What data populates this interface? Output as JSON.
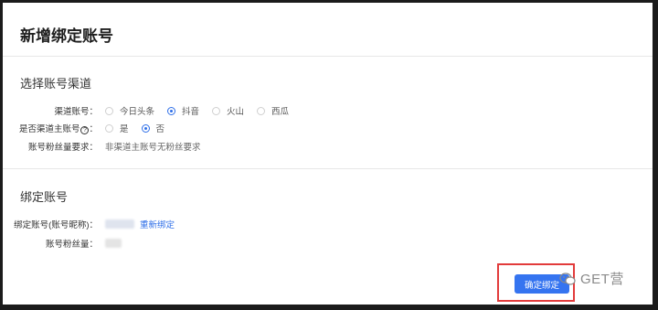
{
  "page_title": "新增绑定账号",
  "section1": {
    "title": "选择账号渠道",
    "channel": {
      "label": "渠道账号：",
      "options": [
        {
          "label": "今日头条",
          "checked": false
        },
        {
          "label": "抖音",
          "checked": true
        },
        {
          "label": "火山",
          "checked": false
        },
        {
          "label": "西瓜",
          "checked": false
        }
      ]
    },
    "is_main": {
      "label": "是否渠道主账号",
      "help_symbol": "?",
      "colon": "：",
      "options": [
        {
          "label": "是",
          "checked": false
        },
        {
          "label": "否",
          "checked": true
        }
      ]
    },
    "fan_req": {
      "label": "账号粉丝量要求：",
      "value": "非渠道主账号无粉丝要求"
    }
  },
  "section2": {
    "title": "绑定账号",
    "account": {
      "label": "绑定账号(账号昵称)：",
      "rebind_link": "重新绑定"
    },
    "fans": {
      "label": "账号粉丝量："
    }
  },
  "confirm_button": "确定绑定",
  "watermark": "GET营",
  "colors": {
    "primary": "#3574f0",
    "highlight_border": "#e23b3b"
  }
}
